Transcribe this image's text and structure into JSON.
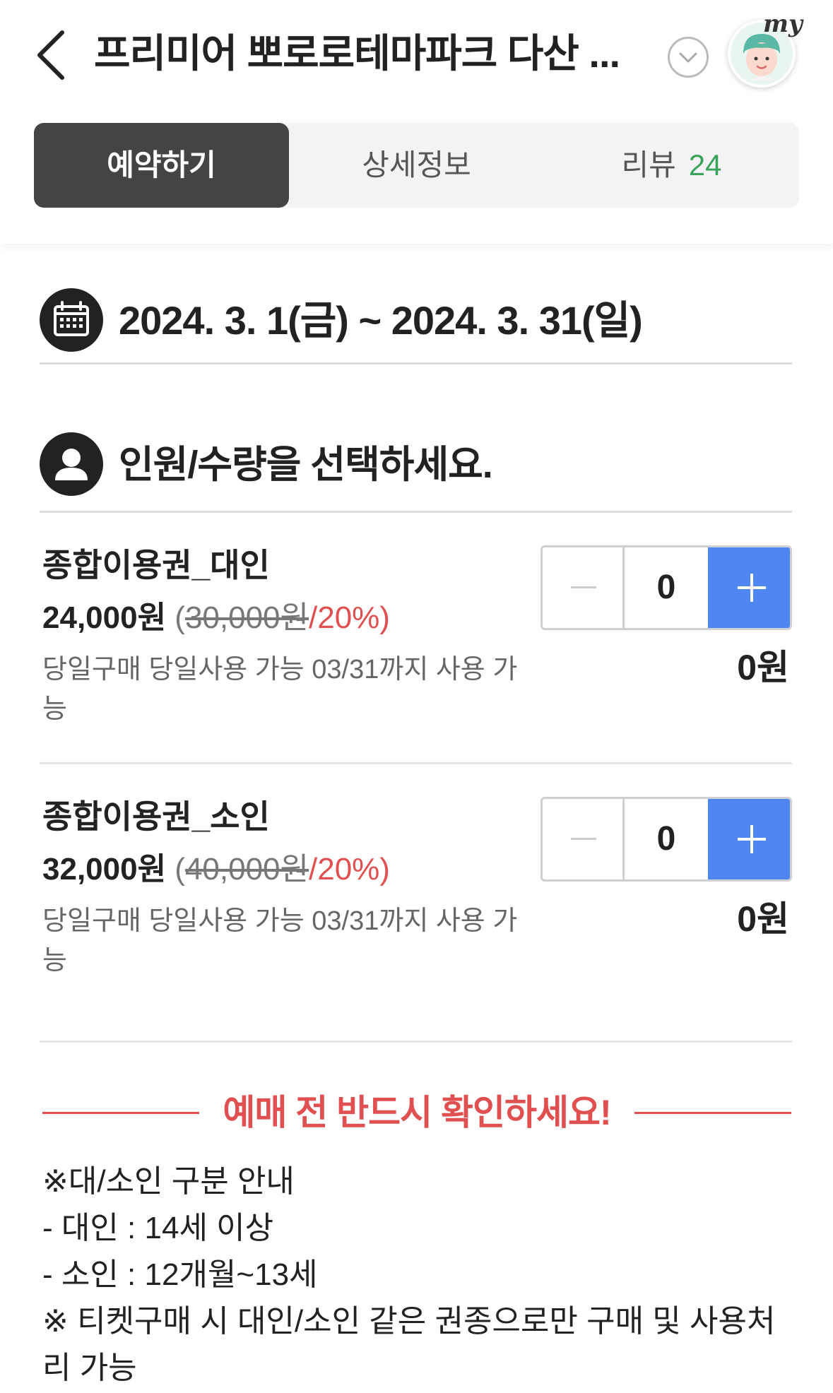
{
  "header": {
    "title": "프리미어 뽀로로테마파크 다산 ...",
    "my_badge": "my"
  },
  "tabs": [
    {
      "label": "예약하기",
      "active": true
    },
    {
      "label": "상세정보",
      "active": false
    },
    {
      "label": "리뷰",
      "count": "24",
      "active": false
    }
  ],
  "date_range": "2024. 3. 1(금) ~ 2024. 3. 31(일)",
  "people_prompt": "인원/수량을 선택하세요.",
  "tickets": [
    {
      "name": "종합이용권_대인",
      "sale_price": "24,000원",
      "open_paren": "(",
      "original_price": "30,000원",
      "discount": "/20%)",
      "note": "당일구매 당일사용 가능 03/31까지 사용 가능",
      "quantity": "0",
      "total": "0원"
    },
    {
      "name": "종합이용권_소인",
      "sale_price": "32,000원",
      "open_paren": "(",
      "original_price": "40,000원",
      "discount": "/20%)",
      "note": "당일구매 당일사용 가능 03/31까지 사용 가능",
      "quantity": "0",
      "total": "0원"
    }
  ],
  "notice": {
    "title": "예매 전 반드시 확인하세요!",
    "lines": [
      "※대/소인 구분 안내",
      "- 대인 : 14세 이상",
      "- 소인 : 12개월~13세",
      "※ 티켓구매 시 대인/소인 같은 권종으로만 구매 및 사용처리 가능"
    ]
  },
  "colors": {
    "accent_blue": "#4f86f2",
    "discount_red": "#e05050",
    "review_green": "#3aa35a",
    "active_tab": "#444447"
  }
}
